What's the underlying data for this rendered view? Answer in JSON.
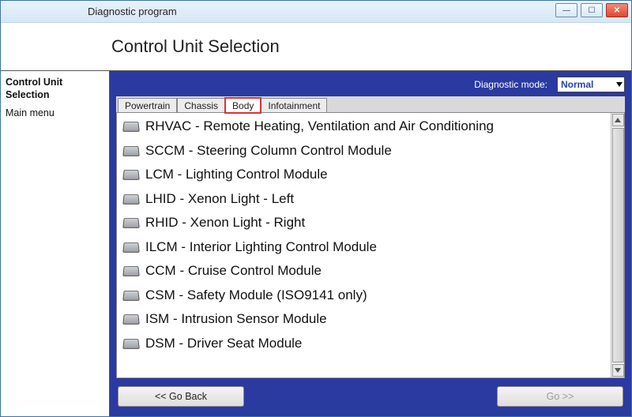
{
  "window": {
    "title": "Diagnostic program"
  },
  "header": {
    "page_title": "Control Unit Selection"
  },
  "sidebar": {
    "items": [
      {
        "label": "Control Unit Selection",
        "active": true
      },
      {
        "label": "Main menu",
        "active": false
      }
    ]
  },
  "diagnostic_mode": {
    "label": "Diagnostic mode:",
    "selected": "Normal"
  },
  "tabs": [
    {
      "label": "Powertrain",
      "active": false
    },
    {
      "label": "Chassis",
      "active": false
    },
    {
      "label": "Body",
      "active": true
    },
    {
      "label": "Infotainment",
      "active": false
    }
  ],
  "modules": [
    "RHVAC - Remote Heating, Ventilation and Air Conditioning",
    "SCCM - Steering Column Control Module",
    "LCM - Lighting Control Module",
    "LHID - Xenon Light - Left",
    "RHID - Xenon Light - Right",
    "ILCM - Interior Lighting Control Module",
    "CCM - Cruise Control Module",
    "CSM - Safety Module (ISO9141 only)",
    "ISM - Intrusion Sensor Module",
    "DSM - Driver Seat Module"
  ],
  "footer": {
    "back_label": "<< Go Back",
    "go_label": "Go >>"
  }
}
